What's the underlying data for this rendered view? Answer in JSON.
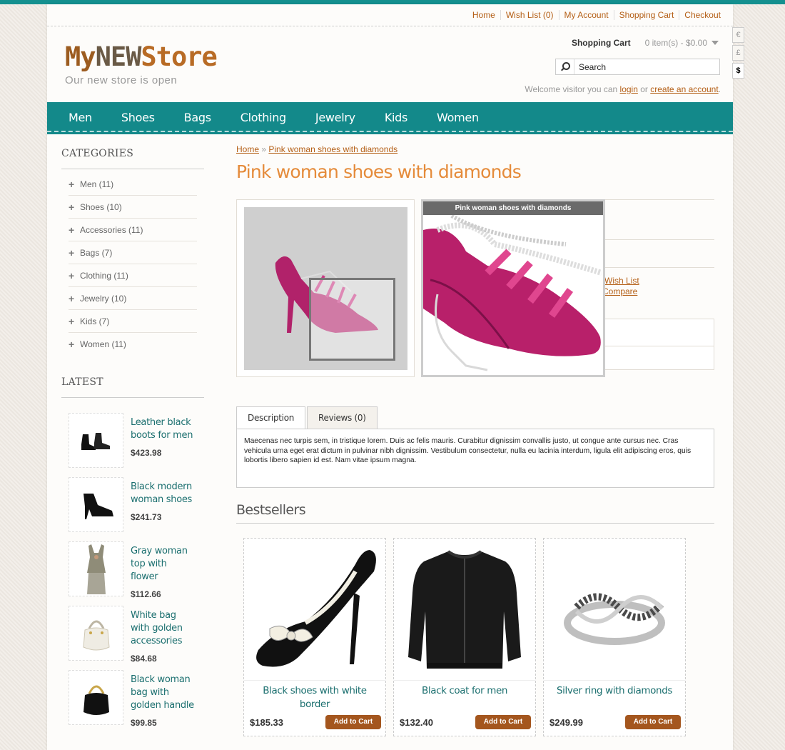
{
  "header": {
    "top_links": [
      "Home",
      "Wish List (0)",
      "My Account",
      "Shopping Cart",
      "Checkout"
    ],
    "logo": {
      "part1": "My",
      "part2": "NEW",
      "part3": "Store"
    },
    "slogan": "Our new store is open",
    "cart_label": "Shopping Cart",
    "cart_value": "0 item(s) - $0.00",
    "search_placeholder": "Search",
    "welcome_prefix": "Welcome visitor you can",
    "welcome_login": "login",
    "welcome_or": "or",
    "welcome_create": "create an account",
    "welcome_suffix": ".",
    "currencies": [
      "€",
      "£",
      "$"
    ]
  },
  "nav": [
    "Men",
    "Shoes",
    "Bags",
    "Clothing",
    "Jewelry",
    "Kids",
    "Women"
  ],
  "sidebar": {
    "categories_title": "CATEGORIES",
    "categories": [
      "Men (11)",
      "Shoes (10)",
      "Accessories (11)",
      "Bags (7)",
      "Clothing (11)",
      "Jewelry (10)",
      "Kids (7)",
      "Women (11)"
    ],
    "latest_title": "LATEST",
    "latest": [
      {
        "name": "Leather black boots for men",
        "price": "$423.98"
      },
      {
        "name": "Black modern woman shoes",
        "price": "$241.73"
      },
      {
        "name": "Gray woman top with flower",
        "price": "$112.66"
      },
      {
        "name": "White bag with golden accessories",
        "price": "$84.68"
      },
      {
        "name": "Black woman bag with golden handle",
        "price": "$99.85"
      }
    ]
  },
  "product": {
    "breadcrumb_home": "Home",
    "breadcrumb_sep": "»",
    "breadcrumb_current": "Pink woman shoes with diamonds",
    "title": "Pink woman shoes with diamonds",
    "zoom_caption": "Pink woman shoes with diamonds",
    "wishlist_fragment": "Wish List",
    "compare_fragment": "Compare",
    "tabs": [
      "Description",
      "Reviews (0)"
    ],
    "description": "Maecenas nec turpis sem, in tristique lorem. Duis ac felis mauris. Curabitur dignissim convallis justo, ut congue ante cursus nec. Cras vehicula urna eget erat dictum in pulvinar nibh dignissim. Vestibulum consectetur, nulla eu lacinia interdum, ligula elit adipiscing eros, quis lobortis libero sapien id est. Nam vitae ipsum magna."
  },
  "bestsellers": {
    "title": "Bestsellers",
    "items": [
      {
        "name": "Black shoes with white border",
        "price": "$185.33",
        "button": "Add to Cart"
      },
      {
        "name": "Black coat for men",
        "price": "$132.40",
        "button": "Add to Cart"
      },
      {
        "name": "Silver ring with diamonds",
        "price": "$249.99",
        "button": "Add to Cart"
      }
    ]
  },
  "colors": {
    "teal": "#13898a",
    "accent": "#e58b3a",
    "link": "#b45f16",
    "button": "#a4561e"
  }
}
